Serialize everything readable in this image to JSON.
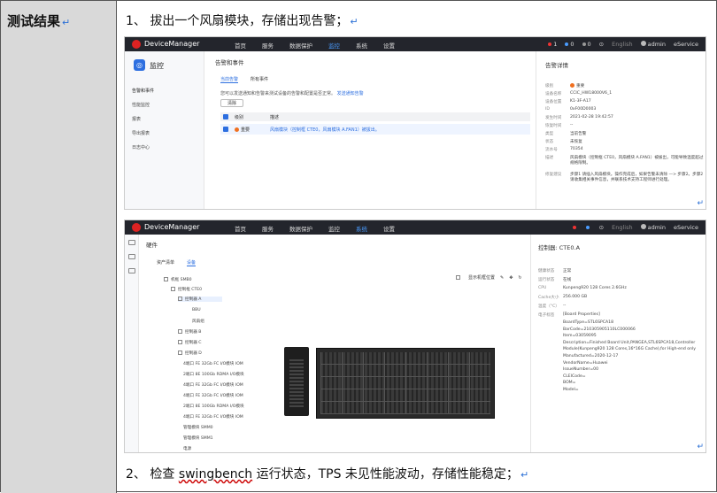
{
  "label_cell": {
    "title": "测试结果",
    "para_mark": "↵"
  },
  "step1": "1、 拔出一个风扇模块，存储出现告警；",
  "step2": {
    "prefix": "2、 检查 ",
    "word": "swingbench",
    "rest": " 运行状态，TPS 未见性能波动，存储性能稳定；"
  },
  "para_mark": "↵",
  "top_bar": {
    "brand": "DeviceManager",
    "nav": [
      "首页",
      "服务",
      "数据保护",
      "监控",
      "系统",
      "设置"
    ],
    "active_nav_s1": "监控",
    "active_nav_s2": "系统",
    "right_s1": [
      "1",
      "0",
      "0",
      "English",
      "admin",
      "eService"
    ],
    "right_s2": [
      "English",
      "admin",
      "eService"
    ]
  },
  "shot1": {
    "sidebar_title": "监控",
    "sidebar_items": [
      "告警和事件",
      "性能监控",
      "报表",
      "导出报表",
      "日志中心"
    ],
    "main_title": "告警和事件",
    "tabs": [
      "当前告警",
      "所有事件"
    ],
    "desc": "您可以发送通知和告警来测试设备的告警和配置是否正常。",
    "desc_link": "发送通知告警",
    "clear_button": "清除",
    "table_headers": [
      "级别",
      "描述"
    ],
    "row": {
      "level": "重要",
      "desc": "风扇模块（控制框 CTE0，风扇模块 A.FAN1）被拔出。"
    },
    "detail_title": "告警详情",
    "details": [
      {
        "k": "级别",
        "v": "重要"
      },
      {
        "k": "设备名称",
        "v": "CCIC_HW18000V6_1"
      },
      {
        "k": "设备位置",
        "v": "K1-3F-A17"
      },
      {
        "k": "ID",
        "v": "0xF00D0003"
      },
      {
        "k": "发生时间",
        "v": "2021-02-28 19:42:57"
      },
      {
        "k": "恢复时间",
        "v": "--"
      },
      {
        "k": "类型",
        "v": "当前告警"
      },
      {
        "k": "状态",
        "v": "未恢复"
      },
      {
        "k": "流水号",
        "v": "70354"
      },
      {
        "k": "描述",
        "v": "风扇模块（控制框 CTE0，风扇模块 A.FAN1）被拔出，可能导致温度超过规格限制。"
      },
      {
        "k": "修复建议",
        "v": "步骤1 请插入风扇模块。操作完成后，如果告警未清除 —> 步骤2。步骤2 请收集相关事件信息，并联系技术支持工程师进行处理。"
      }
    ]
  },
  "shot2": {
    "main_title": "硬件",
    "tabs": [
      "资产清单",
      "设备"
    ],
    "show_position": "显示机框位置",
    "tree": [
      "机框 SMB0",
      "控制框 CTE0",
      "控制器 A",
      "BBU",
      "风扇组",
      "控制器 B",
      "控制器 C",
      "控制器 D",
      "4端口 FE 32Gb FC I/O模块 IOM",
      "2端口 8E 100Gb RDMA I/O模块",
      "4端口 FE 32Gb FC I/O模块 IOM",
      "4端口 FE 32Gb FC I/O模块 IOM",
      "2端口 8E 100Gb RDMA I/O模块",
      "4端口 FE 32Gb FC I/O模块 IOM",
      "管理模块 SMM0",
      "管理模块 SMM1",
      "电源"
    ],
    "detail_title": "控制器: CTE0.A",
    "details": [
      {
        "k": "健康状态",
        "v": "正常"
      },
      {
        "k": "运行状态",
        "v": "在线"
      },
      {
        "k": "CPU",
        "v": "Kunpeng920 128 Cores 2.6GHz"
      },
      {
        "k": "Cache大小",
        "v": "256.000 GB"
      },
      {
        "k": "温度（°C）",
        "v": "--"
      },
      {
        "k": "电子标签",
        "v": "[Board Properties]"
      }
    ],
    "elabel_lines": [
      "BoardType=STL6SPCA18",
      "BarCode=210305905110LC000066",
      "Item=03059095",
      "Description=Finished Board Unit,PANGEA,STL6SPCA18,Controller",
      "Module(Kunpeng920 128 Cores,16*16G Cache),for High-end only",
      "Manufactured=2020-12-17",
      "VendorName=Huawei",
      "IssueNumber=00",
      "CLEICode=",
      "BOM=",
      "Model="
    ]
  }
}
